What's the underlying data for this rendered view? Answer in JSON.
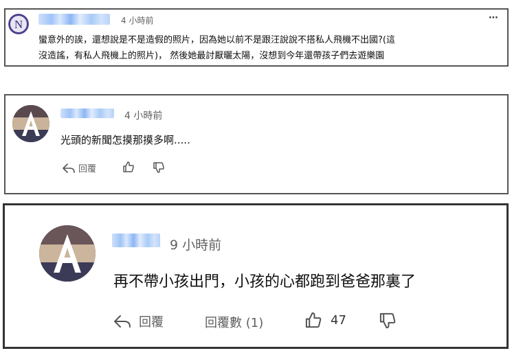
{
  "comments": [
    {
      "avatar_letter": "N",
      "time": "4 小時前",
      "text_lines": [
        "蠻意外的誒，還想說是不是造假的照片，因為她以前不是跟汪說說不搭私人飛機不出國?(這",
        "沒造謠，有私人飛機上的照片)， 然後她最討厭曬太陽，沒想到今年還帶孩子們去遊樂園"
      ],
      "more_icon": "more-dots-icon"
    },
    {
      "avatar_letter": "A",
      "time": "4 小時前",
      "text": "光頭的新聞怎摸那摸多啊.....",
      "reply_label": "回覆",
      "icons": [
        "reply-icon",
        "thumbs-up-icon",
        "thumbs-down-icon"
      ]
    },
    {
      "avatar_letter": "A",
      "time": "9 小時前",
      "text": "再不帶小孩出門，小孩的心都跑到爸爸那裏了",
      "reply_label": "回覆",
      "replies_label": "回覆數 (1)",
      "like_count": "47",
      "icons": [
        "reply-icon",
        "thumbs-up-icon",
        "thumbs-down-icon"
      ]
    }
  ],
  "colors": {
    "text": "#0f0f0f",
    "meta": "#606060",
    "name_blur": "#9fc4f7",
    "border": "#555555"
  }
}
